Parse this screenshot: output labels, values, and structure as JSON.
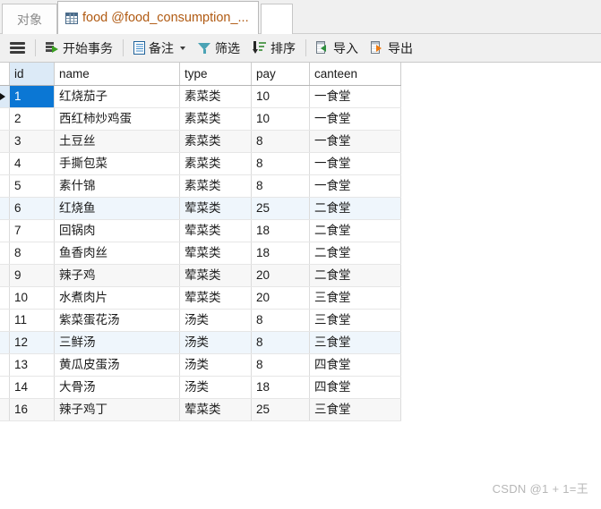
{
  "tabs": {
    "object_tab": {
      "label": "对象",
      "active": false
    },
    "active_tab": {
      "label": "food @food_consumption_...",
      "icon": "table-grid-icon",
      "active": true
    },
    "blank_tab": {
      "label": ""
    }
  },
  "toolbar": {
    "menu_icon": "hamburger-menu-icon",
    "buttons": [
      {
        "label": "开始事务",
        "icon": "begin-transaction-icon",
        "has_caret": false
      },
      {
        "label": "备注",
        "icon": "note-document-icon",
        "has_caret": true
      },
      {
        "label": "筛选",
        "icon": "filter-funnel-icon",
        "has_caret": false
      },
      {
        "label": "排序",
        "icon": "sort-icon",
        "has_caret": false
      },
      {
        "label": "导入",
        "icon": "import-sheet-icon",
        "has_caret": false
      },
      {
        "label": "导出",
        "icon": "export-sheet-icon",
        "has_caret": false
      }
    ]
  },
  "table": {
    "columns": [
      "id",
      "name",
      "type",
      "pay",
      "canteen"
    ],
    "selected_column": "id",
    "selected_row_index": 0,
    "rows": [
      {
        "id": "1",
        "name": "红烧茄子",
        "type": "素菜类",
        "pay": "10",
        "canteen": "一食堂",
        "stripe": "none"
      },
      {
        "id": "2",
        "name": "西红柿炒鸡蛋",
        "type": "素菜类",
        "pay": "10",
        "canteen": "一食堂",
        "stripe": "none"
      },
      {
        "id": "3",
        "name": "土豆丝",
        "type": "素菜类",
        "pay": "8",
        "canteen": "一食堂",
        "stripe": "grey"
      },
      {
        "id": "4",
        "name": "手撕包菜",
        "type": "素菜类",
        "pay": "8",
        "canteen": "一食堂",
        "stripe": "none"
      },
      {
        "id": "5",
        "name": "素什锦",
        "type": "素菜类",
        "pay": "8",
        "canteen": "一食堂",
        "stripe": "none"
      },
      {
        "id": "6",
        "name": "红烧鱼",
        "type": "荤菜类",
        "pay": "25",
        "canteen": "二食堂",
        "stripe": "blue"
      },
      {
        "id": "7",
        "name": "回锅肉",
        "type": "荤菜类",
        "pay": "18",
        "canteen": "二食堂",
        "stripe": "none"
      },
      {
        "id": "8",
        "name": "鱼香肉丝",
        "type": "荤菜类",
        "pay": "18",
        "canteen": "二食堂",
        "stripe": "none"
      },
      {
        "id": "9",
        "name": "辣子鸡",
        "type": "荤菜类",
        "pay": "20",
        "canteen": "二食堂",
        "stripe": "grey"
      },
      {
        "id": "10",
        "name": "水煮肉片",
        "type": "荤菜类",
        "pay": "20",
        "canteen": "三食堂",
        "stripe": "none"
      },
      {
        "id": "11",
        "name": "紫菜蛋花汤",
        "type": "汤类",
        "pay": "8",
        "canteen": "三食堂",
        "stripe": "none"
      },
      {
        "id": "12",
        "name": "三鲜汤",
        "type": "汤类",
        "pay": "8",
        "canteen": "三食堂",
        "stripe": "blue"
      },
      {
        "id": "13",
        "name": "黄瓜皮蛋汤",
        "type": "汤类",
        "pay": "8",
        "canteen": "四食堂",
        "stripe": "none"
      },
      {
        "id": "14",
        "name": "大骨汤",
        "type": "汤类",
        "pay": "18",
        "canteen": "四食堂",
        "stripe": "none"
      },
      {
        "id": "16",
        "name": "辣子鸡丁",
        "type": "荤菜类",
        "pay": "25",
        "canteen": "三食堂",
        "stripe": "grey"
      }
    ]
  },
  "watermark": {
    "text": "CSDN @1 + 1=王"
  },
  "colors": {
    "tab_active_text": "#b05a12",
    "selection_blue": "#0b77d4",
    "header_selected_col": "#dceaf7",
    "stripe_grey": "#f7f7f7",
    "stripe_blue": "#eff6fc",
    "chrome_bg": "#f0f0f0"
  }
}
